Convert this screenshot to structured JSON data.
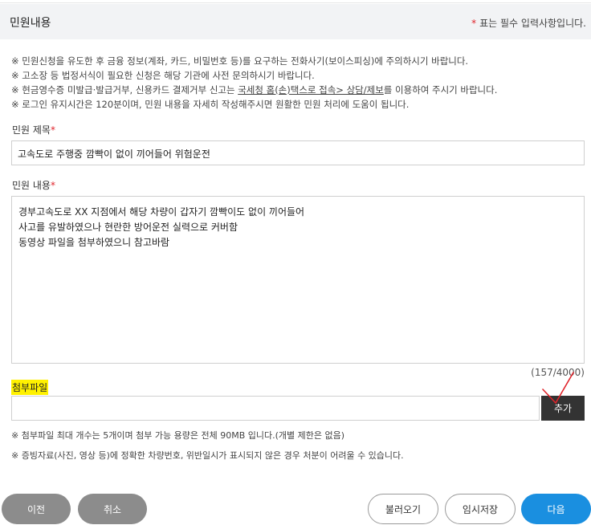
{
  "header": {
    "title": "민원내용",
    "required_star": "*",
    "required_text": "표는 필수 입력사항입니다."
  },
  "notices": {
    "line1": "※ 민원신청을 유도한 후 금융 정보(계좌, 카드, 비밀번호 등)를 요구하는 전화사기(보이스피싱)에 주의하시기 바랍니다.",
    "line2": "※ 고소장 등 법정서식이 필요한 신청은 해당 기관에 사전 문의하시기 바랍니다.",
    "line3_pre": "※ 현금영수증 미발급·발급거부, 신용카드 결제거부 신고는 ",
    "line3_link1": "국세청 홈(손)택스로 접속> 상담/제보",
    "line3_post": "를 이용하여 주시기 바랍니다.",
    "line4": "※ 로그인 유지시간은 120분이며, 민원 내용을 자세히 작성해주시면 원활한 민원 처리에 도움이 됩니다."
  },
  "form": {
    "title_label": "민원 제목",
    "title_value": "고속도로 주행중 깜빡이 없이 끼어들어 위험운전",
    "content_label": "민원 내용",
    "content_value": "경부고속도로 XX 지점에서 해당 차량이 갑자기 깜빡이도 없이 끼어들어\n사고를 유발하였으나 현란한 방어운전 실력으로 커버함\n동영상 파일을 첨부하였으니 참고바람",
    "required_star": "*",
    "counter": "(157/4000)"
  },
  "attach": {
    "label": "첨부파일",
    "add_button": "추가",
    "note1": "※ 첨부파일 최대 개수는 5개이며 첨부 가능 용량은 전체 90MB 입니다.(개별 제한은 없음)",
    "note2": "※ 증빙자료(사진, 영상 등)에 정확한 차량번호, 위반일시가 표시되지 않은 경우 처분이 어려울 수 있습니다."
  },
  "buttons": {
    "prev": "이전",
    "cancel": "취소",
    "load": "불러오기",
    "temp_save": "임시저장",
    "next": "다음"
  },
  "colors": {
    "accent_blue": "#1a8fe0",
    "required_red": "#e0242b",
    "highlight_yellow": "#fff100",
    "annotation_red": "#e0242b"
  },
  "icons": {
    "annotation": "red-check-mark-icon"
  }
}
